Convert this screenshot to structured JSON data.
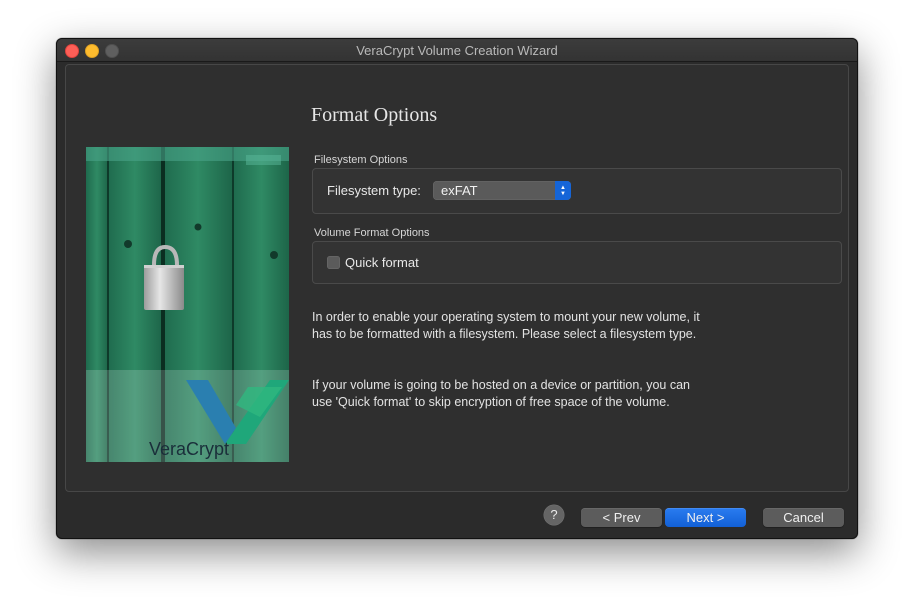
{
  "window": {
    "title": "VeraCrypt Volume Creation Wizard"
  },
  "sidebar_image": {
    "logo_text": "VeraCrypt",
    "icon": "padlock-on-green-door-image"
  },
  "page": {
    "title": "Format Options"
  },
  "filesystem_options": {
    "group_label": "Filesystem Options",
    "type_label": "Filesystem type:",
    "type_value": "exFAT"
  },
  "volume_format_options": {
    "group_label": "Volume Format Options",
    "quick_format_label": "Quick format",
    "quick_format_checked": false
  },
  "info": {
    "paragraph1": "In order to enable your operating system to mount your new volume, it has to be formatted with a filesystem. Please select a filesystem type.",
    "paragraph2": "If your volume is going to be hosted on a device or partition, you can use 'Quick format' to skip encryption of free space of the volume."
  },
  "buttons": {
    "help": "?",
    "prev": "< Prev",
    "next": "Next >",
    "cancel": "Cancel"
  },
  "colors": {
    "accent": "#1565d8",
    "close": "#fe5f57",
    "minimize": "#febc2e"
  }
}
